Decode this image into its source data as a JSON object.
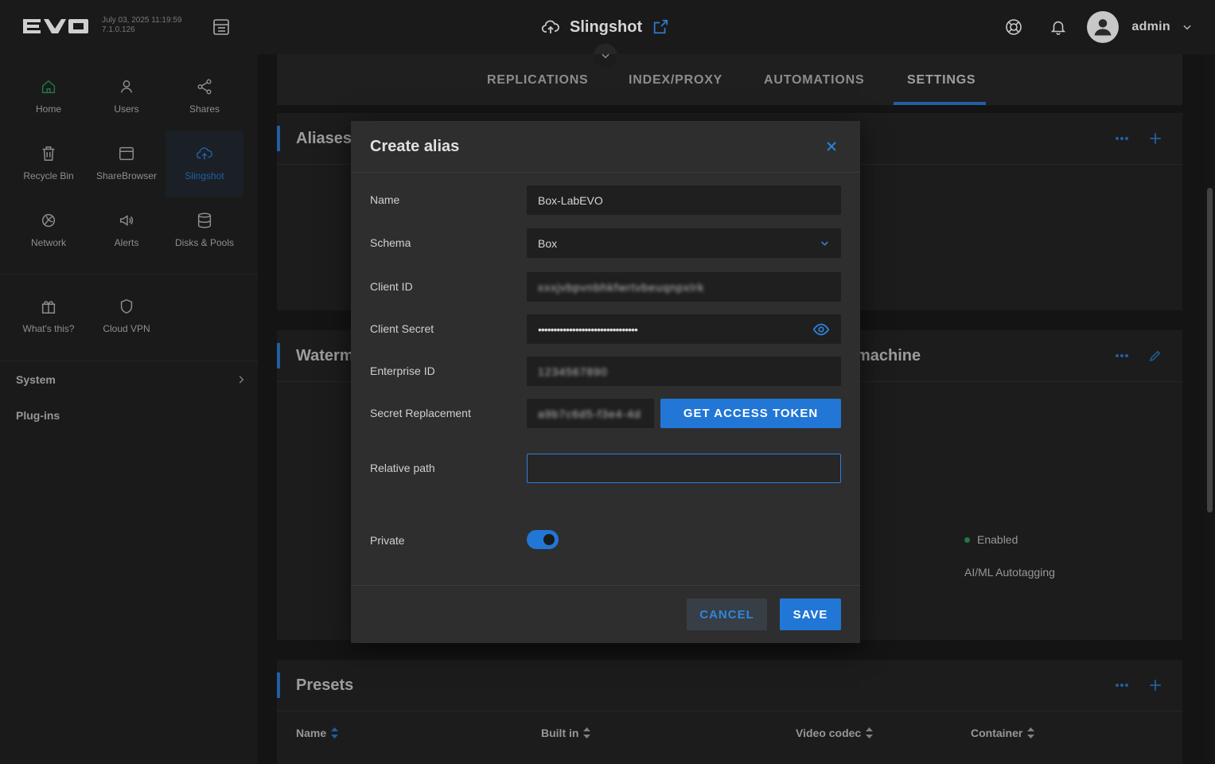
{
  "topbar": {
    "logo_text": "EVO",
    "date": "July 03, 2025 11:19:59",
    "version": "7.1.0.126",
    "page_title": "Slingshot",
    "user_name": "admin"
  },
  "sidebar": {
    "tiles": [
      {
        "label": "Home",
        "icon": "home-icon"
      },
      {
        "label": "Users",
        "icon": "user-icon"
      },
      {
        "label": "Shares",
        "icon": "share-icon"
      },
      {
        "label": "Recycle Bin",
        "icon": "trash-icon"
      },
      {
        "label": "ShareBrowser",
        "icon": "browser-icon"
      },
      {
        "label": "Slingshot",
        "icon": "cloud-upload-icon",
        "active": true
      },
      {
        "label": "Network",
        "icon": "network-icon"
      },
      {
        "label": "Alerts",
        "icon": "megaphone-icon"
      },
      {
        "label": "Disks & Pools",
        "icon": "database-icon"
      }
    ],
    "extra_tiles": [
      {
        "label": "What's this?",
        "icon": "gift-icon"
      },
      {
        "label": "Cloud VPN",
        "icon": "shield-icon"
      }
    ],
    "system": "System",
    "plugins": "Plug-ins"
  },
  "tabs": [
    "REPLICATIONS",
    "INDEX/PROXY",
    "AUTOMATIONS",
    "SETTINGS"
  ],
  "cards": {
    "aliases": "Aliases",
    "watermark": "Waterm",
    "machine": "machine",
    "enabled": "Enabled",
    "autotag": "AI/ML Autotagging",
    "presets": "Presets",
    "preset_columns": [
      "Name",
      "Built in",
      "Video codec",
      "Container"
    ]
  },
  "modal": {
    "title": "Create alias",
    "name_label": "Name",
    "name_value": "Box-LabEVO",
    "schema_label": "Schema",
    "schema_value": "Box",
    "client_id_label": "Client ID",
    "client_id_value": "xxxjvbpvnbhkfwrtvbeuqnpxlrk",
    "client_secret_label": "Client Secret",
    "client_secret_value": "••••••••••••••••••••••••••••••••",
    "enterprise_id_label": "Enterprise ID",
    "enterprise_id_value": "1234567890",
    "secret_repl_label": "Secret Replacement",
    "secret_repl_value": "a9b7c6d5-f3e4-4d",
    "get_token": "GET ACCESS TOKEN",
    "relative_path_label": "Relative path",
    "relative_path_value": "",
    "private_label": "Private",
    "private_on": true,
    "cancel": "CANCEL",
    "save": "SAVE"
  },
  "colors": {
    "accent": "#2176d6",
    "home_active": "#2e9b63"
  }
}
